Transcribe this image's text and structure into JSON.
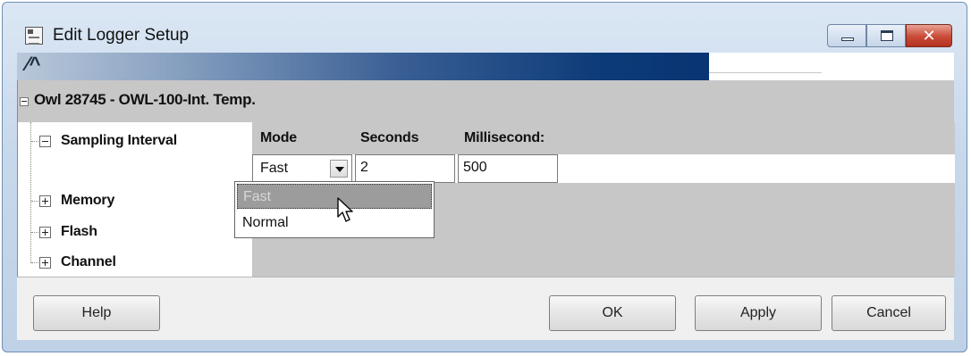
{
  "window": {
    "title": "Edit Logger Setup",
    "close_glyph": "✕",
    "icons": {
      "app": "logger-app-icon",
      "minimize": "minimize-icon",
      "maximize": "maximize-icon",
      "close": "close-icon"
    }
  },
  "banner": {
    "logo_text": "⁄^"
  },
  "logger": {
    "title": "Owl 28745 - OWL-100-Int. Temp.",
    "tree": [
      {
        "label": "Sampling Interval",
        "expanded": true
      },
      {
        "label": "Memory",
        "expanded": false
      },
      {
        "label": "Flash",
        "expanded": false
      },
      {
        "label": "Channel",
        "expanded": false
      }
    ]
  },
  "sampling": {
    "headers": {
      "mode": "Mode",
      "seconds": "Seconds",
      "milliseconds": "Millisecond:"
    },
    "mode_value": "Fast",
    "seconds_value": "2",
    "milliseconds_value": "500",
    "mode_options": [
      "Fast",
      "Normal"
    ],
    "highlighted_option": "Fast"
  },
  "footer": {
    "help": "Help",
    "ok": "OK",
    "apply": "Apply",
    "cancel": "Cancel"
  },
  "colors": {
    "banner_dark": "#0a3473",
    "panel_gray": "#c7c7c7",
    "close_red": "#c84a36"
  }
}
